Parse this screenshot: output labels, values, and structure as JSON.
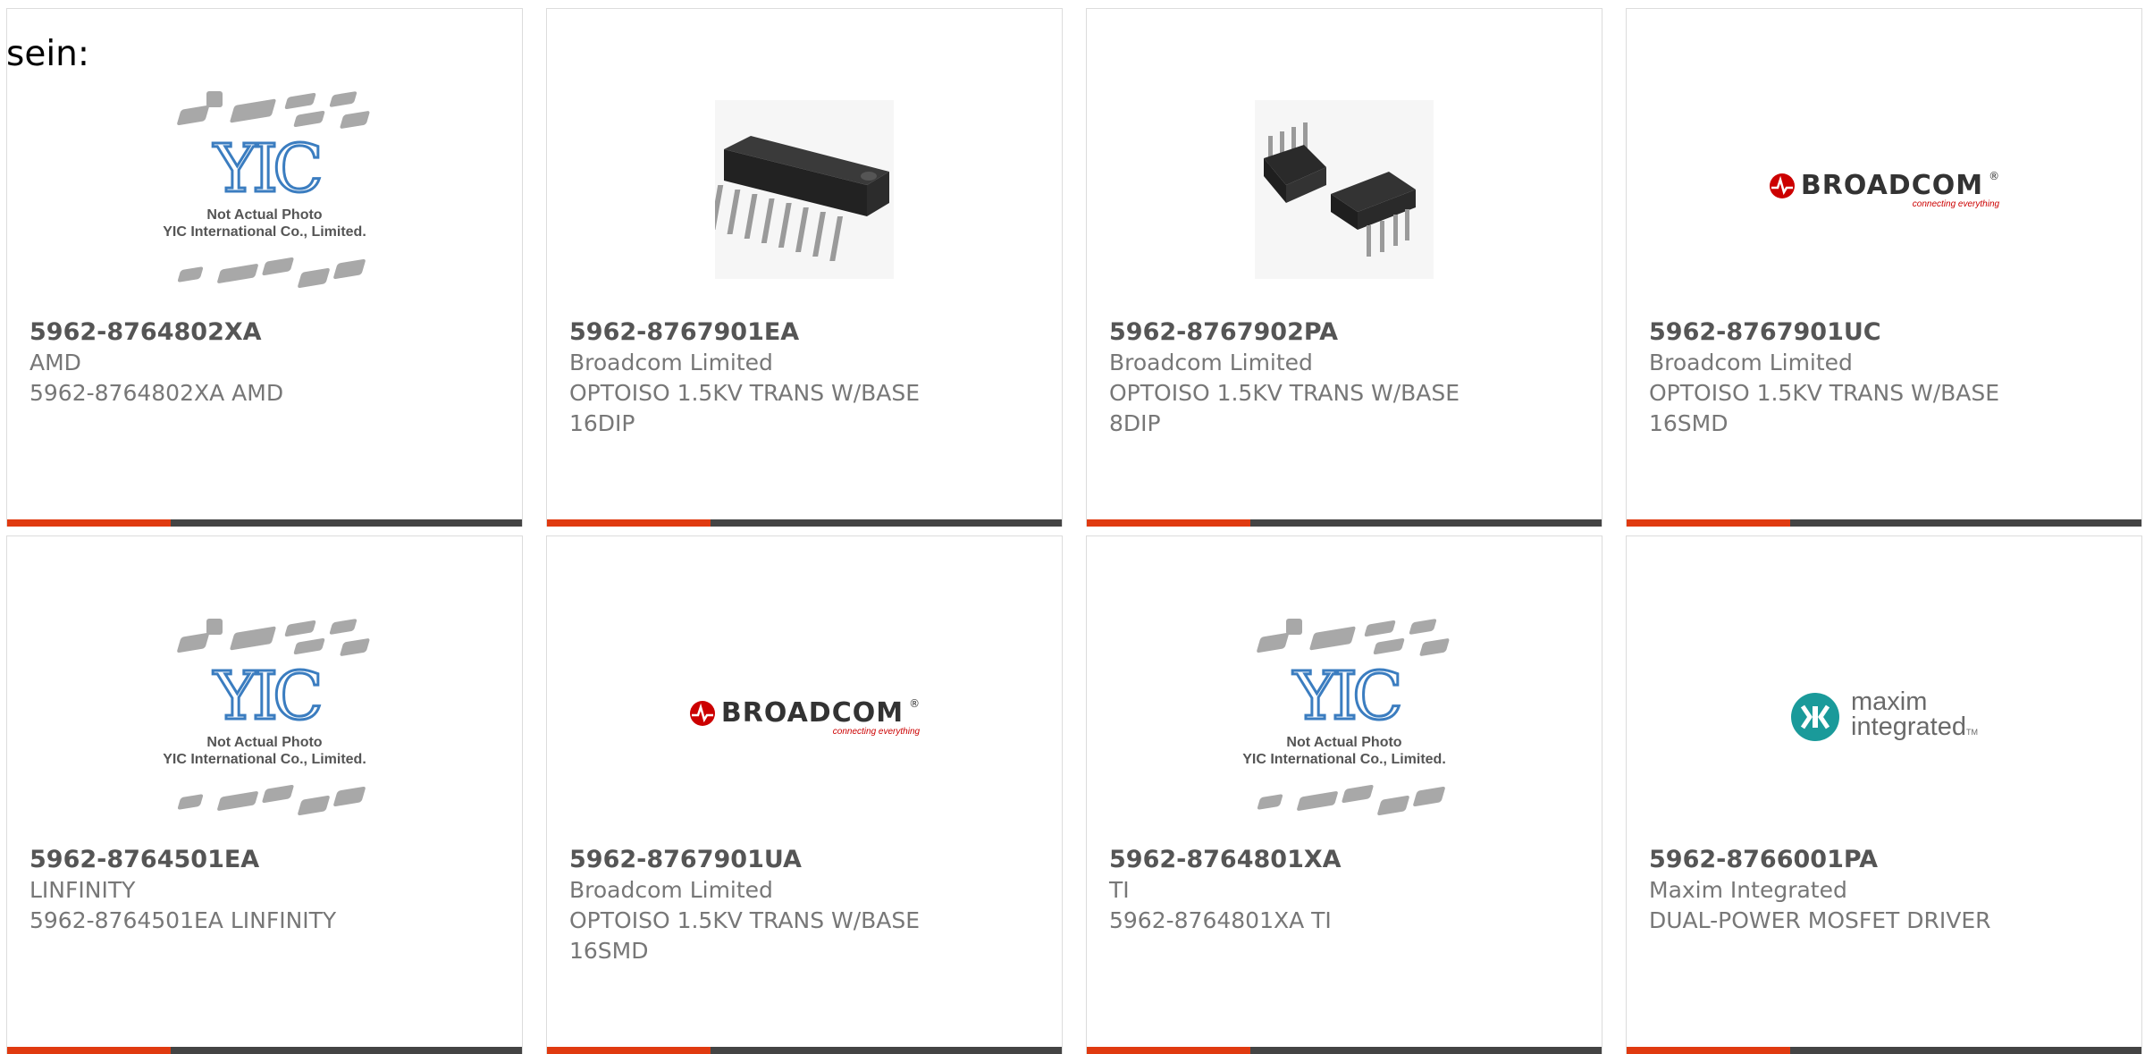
{
  "intro_text": "sein:",
  "colors": {
    "accent": "#e03a10",
    "bar": "#444444",
    "yic_blue": "#3b7dc0",
    "broadcom_red": "#cc0000",
    "maxim_teal": "#1a9a9a"
  },
  "placeholder": {
    "logo_text": "YIC",
    "line1": "Not Actual Photo",
    "line2": "YIC International Co., Limited."
  },
  "broadcom": {
    "name": "BROADCOM",
    "tagline": "connecting everything",
    "trademark": "®"
  },
  "maxim": {
    "line1": "maxim",
    "line2": "integrated",
    "tm": "TM"
  },
  "products": [
    {
      "part": "5962-8764802XA",
      "manufacturer": "AMD",
      "desc1": "5962-8764802XA AMD",
      "desc2": "",
      "image": "yic-placeholder"
    },
    {
      "part": "5962-8767901EA",
      "manufacturer": "Broadcom Limited",
      "desc1": "OPTOISO 1.5KV TRANS W/BASE",
      "desc2": "16DIP",
      "image": "dip16-icon"
    },
    {
      "part": "5962-8767902PA",
      "manufacturer": "Broadcom Limited",
      "desc1": "OPTOISO 1.5KV TRANS W/BASE",
      "desc2": "8DIP",
      "image": "dip8-icon"
    },
    {
      "part": "5962-8767901UC",
      "manufacturer": "Broadcom Limited",
      "desc1": "OPTOISO 1.5KV TRANS W/BASE",
      "desc2": "16SMD",
      "image": "broadcom-logo"
    },
    {
      "part": "5962-8764501EA",
      "manufacturer": "LINFINITY",
      "desc1": "5962-8764501EA LINFINITY",
      "desc2": "",
      "image": "yic-placeholder"
    },
    {
      "part": "5962-8767901UA",
      "manufacturer": "Broadcom Limited",
      "desc1": "OPTOISO 1.5KV TRANS W/BASE",
      "desc2": "16SMD",
      "image": "broadcom-logo"
    },
    {
      "part": "5962-8764801XA",
      "manufacturer": "TI",
      "desc1": "5962-8764801XA TI",
      "desc2": "",
      "image": "yic-placeholder"
    },
    {
      "part": "5962-8766001PA",
      "manufacturer": "Maxim Integrated",
      "desc1": "DUAL-POWER MOSFET DRIVER",
      "desc2": "",
      "image": "maxim-logo"
    }
  ]
}
